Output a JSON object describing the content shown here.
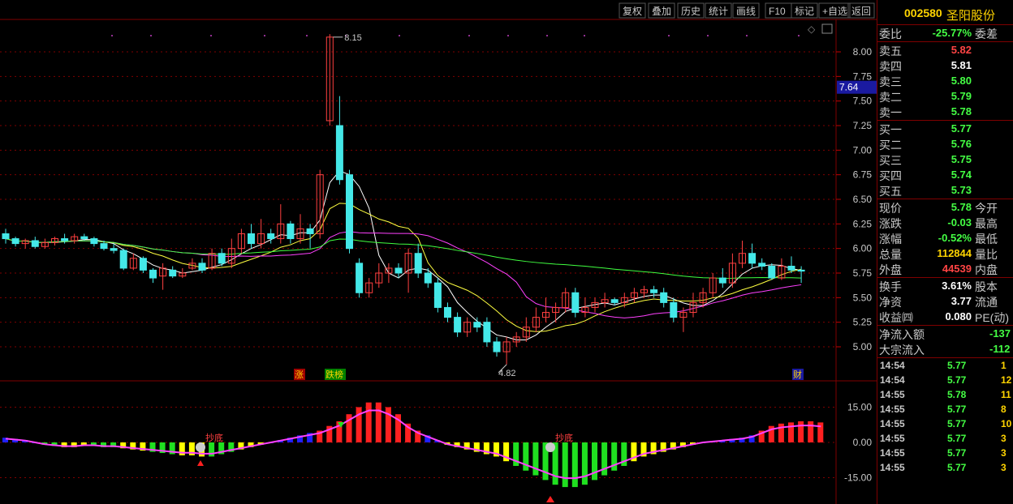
{
  "toolbar": {
    "buttons": [
      "复权",
      "叠加",
      "历史",
      "统计",
      "画线",
      "F10",
      "标记",
      "+自选",
      "返回"
    ]
  },
  "stock": {
    "code": "002580",
    "name": "圣阳股份"
  },
  "quote": {
    "weibi_label": "委比",
    "weibi_value": "-25.77%",
    "weicha_label": "委差",
    "asks": [
      {
        "label": "卖五",
        "price": "5.82",
        "color": "red"
      },
      {
        "label": "卖四",
        "price": "5.81",
        "color": "white"
      },
      {
        "label": "卖三",
        "price": "5.80",
        "color": "green"
      },
      {
        "label": "卖二",
        "price": "5.79",
        "color": "green"
      },
      {
        "label": "卖一",
        "price": "5.78",
        "color": "green"
      }
    ],
    "bids": [
      {
        "label": "买一",
        "price": "5.77"
      },
      {
        "label": "买二",
        "price": "5.76"
      },
      {
        "label": "买三",
        "price": "5.75"
      },
      {
        "label": "买四",
        "price": "5.74"
      },
      {
        "label": "买五",
        "price": "5.73"
      }
    ],
    "stats": [
      {
        "label": "现价",
        "value": "5.78",
        "right": "今开",
        "color": "green"
      },
      {
        "label": "涨跌",
        "value": "-0.03",
        "right": "最高",
        "color": "green"
      },
      {
        "label": "涨幅",
        "value": "-0.52%",
        "right": "最低",
        "color": "green"
      },
      {
        "label": "总量",
        "value": "112844",
        "right": "量比",
        "color": "yellow"
      },
      {
        "label": "外盘",
        "value": "44539",
        "right": "内盘",
        "color": "red"
      }
    ],
    "stats2": [
      {
        "label": "换手",
        "value": "3.61%",
        "right": "股本"
      },
      {
        "label": "净资",
        "value": "3.77",
        "right": "流通"
      },
      {
        "label": "收益㈣",
        "value": "0.080",
        "right": "PE(动)"
      }
    ],
    "flows": [
      {
        "label": "净流入额",
        "value": "-137"
      },
      {
        "label": "大宗流入",
        "value": "-112"
      }
    ]
  },
  "ticks": [
    {
      "time": "14:54",
      "price": "5.77",
      "qty": "1"
    },
    {
      "time": "14:54",
      "price": "5.77",
      "qty": "12"
    },
    {
      "time": "14:55",
      "price": "5.78",
      "qty": "11"
    },
    {
      "time": "14:55",
      "price": "5.77",
      "qty": "8"
    },
    {
      "time": "14:55",
      "price": "5.77",
      "qty": "10"
    },
    {
      "time": "14:55",
      "price": "5.77",
      "qty": "3"
    },
    {
      "time": "14:55",
      "price": "5.77",
      "qty": "3"
    },
    {
      "time": "14:55",
      "price": "5.77",
      "qty": "3"
    }
  ],
  "chart_data": [
    {
      "type": "candlestick",
      "yticks": [
        "8.00",
        "7.75",
        "7.50",
        "7.25",
        "7.00",
        "6.75",
        "6.50",
        "6.25",
        "6.00",
        "5.75",
        "5.50",
        "5.25",
        "5.00"
      ],
      "current_price_label": "7.64",
      "high_label": "8.15",
      "low_label": "4.82",
      "markers": [
        "涨",
        "跌榜",
        "财"
      ],
      "candles": [
        [
          6.15,
          6.1,
          6.2,
          6.05
        ],
        [
          6.1,
          6.05,
          6.12,
          6.02
        ],
        [
          6.05,
          6.08,
          6.1,
          6.0
        ],
        [
          6.08,
          6.02,
          6.12,
          6.0
        ],
        [
          6.02,
          6.06,
          6.1,
          6.0
        ],
        [
          6.06,
          6.1,
          6.12,
          6.03
        ],
        [
          6.1,
          6.08,
          6.15,
          6.05
        ],
        [
          6.08,
          6.12,
          6.15,
          6.05
        ],
        [
          6.12,
          6.1,
          6.15,
          6.08
        ],
        [
          6.1,
          6.05,
          6.12,
          6.02
        ],
        [
          6.05,
          6.0,
          6.08,
          5.98
        ],
        [
          6.0,
          5.98,
          6.05,
          5.95
        ],
        [
          5.98,
          5.8,
          6.0,
          5.78
        ],
        [
          5.8,
          5.9,
          5.95,
          5.78
        ],
        [
          5.9,
          5.78,
          5.92,
          5.75
        ],
        [
          5.78,
          5.7,
          5.8,
          5.65
        ],
        [
          5.72,
          5.8,
          5.85,
          5.58
        ],
        [
          5.78,
          5.72,
          5.82,
          5.7
        ],
        [
          5.72,
          5.75,
          5.8,
          5.7
        ],
        [
          5.8,
          5.85,
          5.9,
          5.78
        ],
        [
          5.85,
          5.78,
          5.9,
          5.75
        ],
        [
          5.8,
          5.95,
          6.0,
          5.78
        ],
        [
          5.95,
          5.85,
          6.0,
          5.82
        ],
        [
          5.85,
          6.0,
          6.1,
          5.8
        ],
        [
          6.0,
          6.15,
          6.2,
          5.95
        ],
        [
          6.15,
          6.05,
          6.25,
          6.0
        ],
        [
          6.05,
          6.15,
          6.3,
          6.0
        ],
        [
          6.15,
          6.1,
          6.2,
          6.05
        ],
        [
          6.1,
          6.25,
          6.45,
          6.05
        ],
        [
          6.25,
          6.1,
          6.28,
          6.05
        ],
        [
          6.1,
          6.2,
          6.35,
          6.05
        ],
        [
          6.2,
          6.15,
          6.25,
          6.0
        ],
        [
          6.15,
          6.75,
          6.8,
          6.1
        ],
        [
          7.3,
          8.15,
          8.18,
          7.25
        ],
        [
          7.25,
          6.7,
          7.55,
          6.65
        ],
        [
          6.75,
          6.0,
          6.8,
          5.95
        ],
        [
          5.85,
          5.55,
          5.9,
          5.5
        ],
        [
          5.55,
          5.65,
          5.7,
          5.5
        ],
        [
          5.65,
          5.75,
          5.85,
          5.6
        ],
        [
          5.75,
          5.8,
          5.85,
          5.65
        ],
        [
          5.8,
          5.75,
          5.85,
          5.7
        ],
        [
          5.75,
          5.95,
          6.0,
          5.55
        ],
        [
          5.95,
          5.75,
          6.05,
          5.7
        ],
        [
          5.75,
          5.65,
          5.8,
          5.6
        ],
        [
          5.65,
          5.4,
          5.7,
          5.35
        ],
        [
          5.4,
          5.3,
          5.45,
          5.25
        ],
        [
          5.3,
          5.15,
          5.35,
          5.1
        ],
        [
          5.15,
          5.25,
          5.3,
          5.1
        ],
        [
          5.25,
          5.2,
          5.3,
          5.15
        ],
        [
          5.25,
          5.05,
          5.3,
          5.0
        ],
        [
          5.05,
          4.95,
          5.1,
          4.9
        ],
        [
          4.95,
          5.05,
          5.1,
          4.82
        ],
        [
          5.05,
          5.1,
          5.15,
          5.0
        ],
        [
          5.1,
          5.2,
          5.3,
          5.05
        ],
        [
          5.2,
          5.3,
          5.4,
          5.15
        ],
        [
          5.3,
          5.35,
          5.5,
          5.25
        ],
        [
          5.35,
          5.4,
          5.45,
          5.25
        ],
        [
          5.4,
          5.55,
          5.6,
          5.35
        ],
        [
          5.55,
          5.35,
          5.6,
          5.3
        ],
        [
          5.35,
          5.4,
          5.5,
          5.3
        ],
        [
          5.4,
          5.45,
          5.5,
          5.35
        ],
        [
          5.45,
          5.48,
          5.55,
          5.4
        ],
        [
          5.48,
          5.45,
          5.5,
          5.42
        ],
        [
          5.45,
          5.5,
          5.55,
          5.4
        ],
        [
          5.5,
          5.55,
          5.6,
          5.45
        ],
        [
          5.55,
          5.58,
          5.62,
          5.5
        ],
        [
          5.58,
          5.55,
          5.62,
          5.5
        ],
        [
          5.55,
          5.45,
          5.6,
          5.4
        ],
        [
          5.45,
          5.3,
          5.5,
          5.25
        ],
        [
          5.3,
          5.35,
          5.4,
          5.15
        ],
        [
          5.35,
          5.45,
          5.55,
          5.3
        ],
        [
          5.45,
          5.55,
          5.6,
          5.4
        ],
        [
          5.55,
          5.7,
          5.75,
          5.5
        ],
        [
          5.7,
          5.65,
          5.8,
          5.6
        ],
        [
          5.65,
          5.85,
          5.95,
          5.6
        ],
        [
          5.85,
          5.95,
          6.08,
          5.8
        ],
        [
          5.95,
          5.85,
          6.05,
          5.8
        ],
        [
          5.85,
          5.82,
          5.9,
          5.78
        ],
        [
          5.82,
          5.7,
          5.85,
          5.68
        ],
        [
          5.7,
          5.82,
          5.9,
          5.68
        ],
        [
          5.82,
          5.78,
          5.92,
          5.75
        ],
        [
          5.78,
          5.77,
          5.82,
          5.65
        ]
      ]
    },
    {
      "type": "bar",
      "yticks": [
        "15.00",
        "0.00",
        "-15.00"
      ],
      "markers": [
        "抄底",
        "抄底"
      ],
      "values": [
        2,
        1.5,
        1,
        0,
        -1,
        -1.5,
        -2,
        -2,
        -1.5,
        -1.5,
        -2,
        -2,
        -2.5,
        -3,
        -3.5,
        -4,
        -4.5,
        -5,
        -5.5,
        -5.5,
        -6,
        -6,
        -5,
        -4,
        -3,
        -2,
        -1,
        0,
        1,
        2,
        3,
        4,
        5,
        7,
        9,
        12,
        15,
        17,
        17,
        15,
        12,
        8,
        5,
        3,
        1,
        -1,
        -2,
        -3,
        -4,
        -5,
        -6,
        -8,
        -10,
        -12,
        -14,
        -16,
        -18,
        -19,
        -19,
        -18,
        -16,
        -14,
        -12,
        -10,
        -8,
        -6,
        -5,
        -4,
        -3,
        -2,
        -1,
        0,
        0.5,
        1,
        1.5,
        2,
        3,
        5,
        7,
        8,
        8.5,
        9,
        9,
        8.5
      ]
    }
  ]
}
